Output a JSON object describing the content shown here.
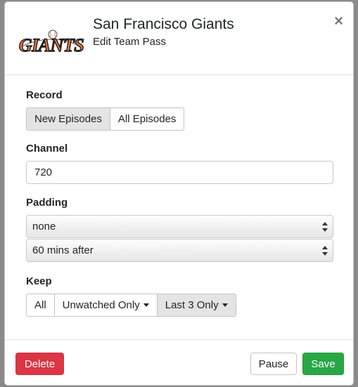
{
  "header": {
    "logo_text": "GIANTS",
    "title": "San Francisco Giants",
    "subtitle": "Edit Team Pass",
    "close_label": "×"
  },
  "record": {
    "label": "Record",
    "options": [
      "New Episodes",
      "All Episodes"
    ],
    "selected": "New Episodes"
  },
  "channel": {
    "label": "Channel",
    "value": "720"
  },
  "padding": {
    "label": "Padding",
    "before": "none",
    "after": "60 mins after"
  },
  "keep": {
    "label": "Keep",
    "all_label": "All",
    "unwatched_label": "Unwatched Only",
    "last_label": "Last 3 Only",
    "selected": "Last 3 Only"
  },
  "footer": {
    "delete_label": "Delete",
    "pause_label": "Pause",
    "save_label": "Save"
  },
  "colors": {
    "logo_orange": "#f4793e",
    "logo_black": "#1a1a1a",
    "delete": "#dc3545",
    "save": "#28a745"
  }
}
